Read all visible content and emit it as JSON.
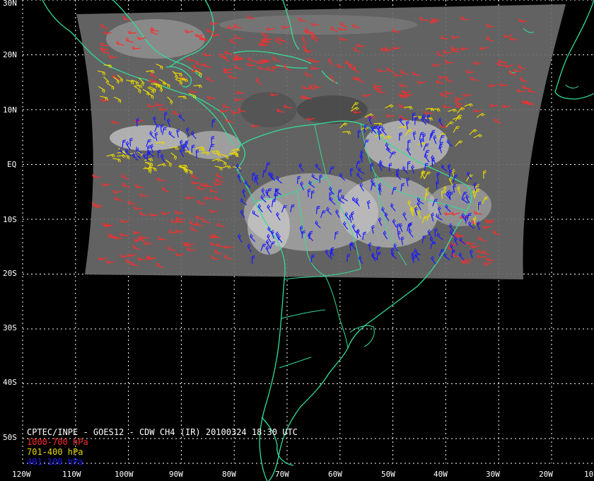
{
  "caption": {
    "title": "CPTEC/INPE - GOES12 - CDW CH4 (IR) 20100324 18:30 UTC",
    "legend": [
      {
        "label": "1000-700 hPa",
        "color": "#ff2b2b"
      },
      {
        "label": "701-400 hPa",
        "color": "#e6d800"
      },
      {
        "label": "401-100 hPa",
        "color": "#1a1aff"
      }
    ]
  },
  "axes": {
    "lat_labels": [
      "30N",
      "20N",
      "10N",
      "EQ",
      "10S",
      "20S",
      "30S",
      "40S",
      "50S"
    ],
    "lon_labels": [
      "120W",
      "110W",
      "100W",
      "90W",
      "80W",
      "70W",
      "60W",
      "50W",
      "40W",
      "30W",
      "20W",
      "10"
    ]
  },
  "colors": {
    "background": "#000000",
    "coastline": "#33dd99",
    "grid": "#ffffff",
    "satellite_swath": "#6a6a6a",
    "cloud": "#e8e8e8"
  }
}
